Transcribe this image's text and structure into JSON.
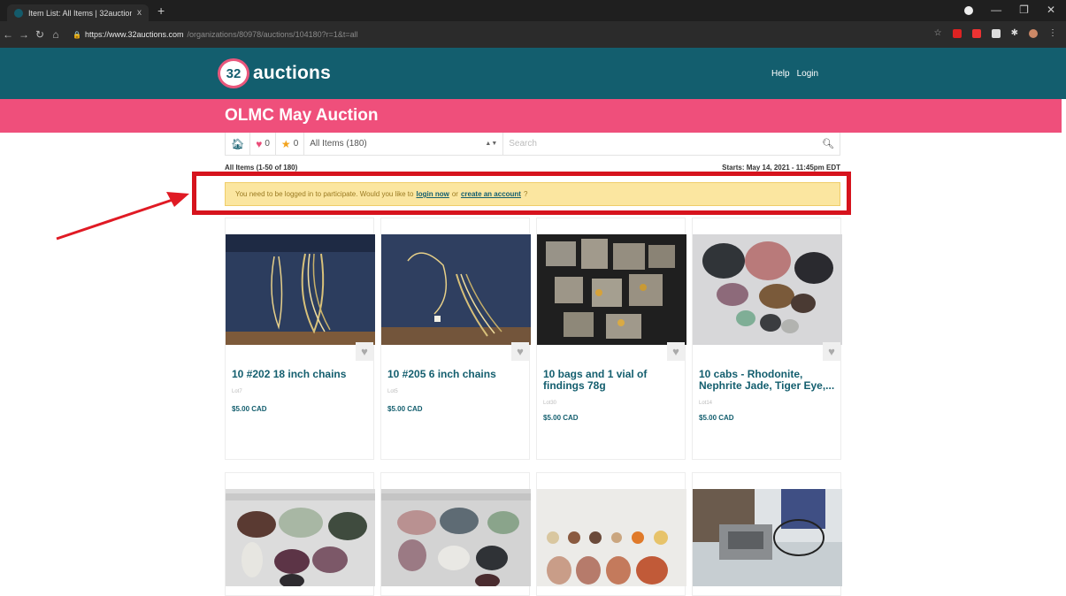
{
  "browser": {
    "tab_title": "Item List: All Items | 32auctions",
    "tab_close": "x",
    "new_tab": "+",
    "url_host": "https://www.32auctions.com",
    "url_path": "/organizations/80978/auctions/104180?r=1&t=all",
    "colors": {
      "chrome": "#1f1f1f",
      "toolbar": "#2b2b2b"
    }
  },
  "site": {
    "logo_number": "32",
    "logo_text": "auctions",
    "help": "Help",
    "login": "Login",
    "colors": {
      "primary": "#135e6e",
      "accent": "#ef4f7b"
    }
  },
  "auction": {
    "title": "OLMC May Auction"
  },
  "filters": {
    "favorites_count": "0",
    "watch_count": "0",
    "category": "All Items (180)",
    "search_placeholder": "Search"
  },
  "list": {
    "count_text": "All Items (1-50 of 180)",
    "starts_text": "Starts: May 14, 2021 - 11:45pm EDT"
  },
  "notice": {
    "prefix": "You need to be logged in to participate. Would you like to",
    "login_link": "login now",
    "middle": "or",
    "create_link": "create an account",
    "suffix": "?"
  },
  "items": [
    {
      "title": "10 #202 18 inch chains",
      "lot": "Lot7",
      "price": "$5.00 CAD"
    },
    {
      "title": "10 #205 6 inch chains",
      "lot": "Lot5",
      "price": "$5.00 CAD"
    },
    {
      "title": "10 bags and 1 vial of findings 78g",
      "lot": "Lot30",
      "price": "$5.00 CAD"
    },
    {
      "title": "10 cabs - Rhodonite, Nephrite Jade, Tiger Eye,...",
      "lot": "Lot14",
      "price": "$5.00 CAD"
    }
  ]
}
